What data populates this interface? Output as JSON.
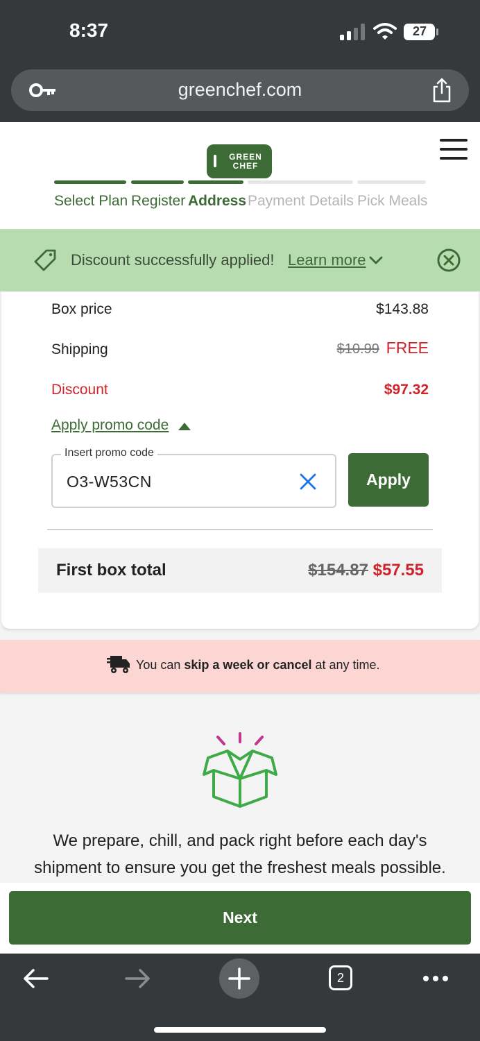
{
  "status_bar": {
    "time": "8:37",
    "battery": "27"
  },
  "browser": {
    "url": "greenchef.com",
    "tab_count": "2"
  },
  "header": {
    "logo_line1": "GREEN",
    "logo_line2": "CHEF",
    "steps": [
      {
        "label": "Select Plan",
        "state": "done"
      },
      {
        "label": "Register",
        "state": "done"
      },
      {
        "label": "Address",
        "state": "current"
      },
      {
        "label": "Payment Details",
        "state": "todo"
      },
      {
        "label": "Pick Meals",
        "state": "todo"
      }
    ]
  },
  "discount_banner": {
    "message": "Discount successfully applied!",
    "learn_more": "Learn more"
  },
  "summary": {
    "box_price_label": "Box price",
    "box_price_value": "$143.88",
    "shipping_label": "Shipping",
    "shipping_old": "$10.99",
    "shipping_new": "FREE",
    "discount_label": "Discount",
    "discount_value": "$97.32",
    "promo_toggle": "Apply promo code",
    "promo_field_label": "Insert promo code",
    "promo_value": "O3-W53CN",
    "apply_label": "Apply",
    "total_label": "First box total",
    "total_old": "$154.87",
    "total_new": "$57.55"
  },
  "skip_banner": {
    "pre": "You can ",
    "bold": "skip a week or cancel",
    "post": " at any time."
  },
  "fresh": {
    "line1": "We prepare, chill, and pack right before each day's",
    "line2": "shipment to ensure you get the freshest meals possible."
  },
  "next_label": "Next",
  "colors": {
    "brand_green": "#3d6b35",
    "discount_red": "#d0232a",
    "banner_green": "#b6dcb0",
    "banner_pink": "#fbd6d3"
  }
}
